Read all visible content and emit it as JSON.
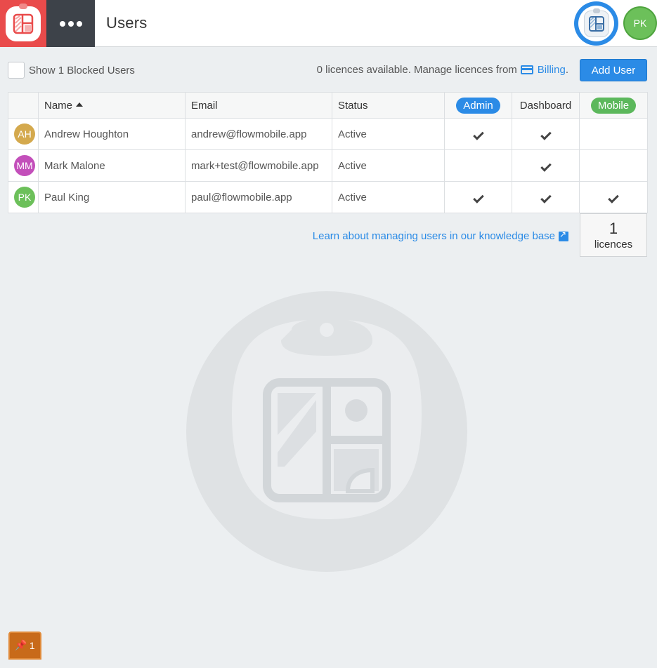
{
  "header": {
    "title": "Users",
    "user_initials": "PK"
  },
  "toolbar": {
    "show_blocked_label": "Show 1 Blocked Users",
    "licence_info": "0 licences available. Manage licences from",
    "billing_label": "Billing",
    "billing_suffix": ".",
    "add_user_label": "Add User"
  },
  "table": {
    "columns": {
      "name": "Name",
      "email": "Email",
      "status": "Status",
      "admin": "Admin",
      "dashboard": "Dashboard",
      "mobile": "Mobile"
    },
    "rows": [
      {
        "initials": "AH",
        "avatar_color": "#d4a94d",
        "name": "Andrew Houghton",
        "email": "andrew@flowmobile.app",
        "status": "Active",
        "admin": true,
        "dashboard": true,
        "mobile": false
      },
      {
        "initials": "MM",
        "avatar_color": "#c34fba",
        "name": "Mark Malone",
        "email": "mark+test@flowmobile.app",
        "status": "Active",
        "admin": false,
        "dashboard": true,
        "mobile": false
      },
      {
        "initials": "PK",
        "avatar_color": "#6cc05a",
        "name": "Paul King",
        "email": "paul@flowmobile.app",
        "status": "Active",
        "admin": true,
        "dashboard": true,
        "mobile": true
      }
    ]
  },
  "footer": {
    "kb_link": "Learn about managing users in our knowledge base",
    "licence_count": "1",
    "licence_label": "licences"
  },
  "pin_badge": {
    "count": "1"
  },
  "colors": {
    "brand_red": "#e94b4b",
    "accent_blue": "#2b8be6",
    "mobile_green": "#5cb85c",
    "pin_orange": "#c86a1a"
  },
  "icons": {
    "menu": "more-dots-icon",
    "app": "flow-app-icon",
    "billing": "credit-card-icon",
    "kb": "external-link-icon",
    "pin": "pin-icon",
    "check": "check-icon"
  }
}
